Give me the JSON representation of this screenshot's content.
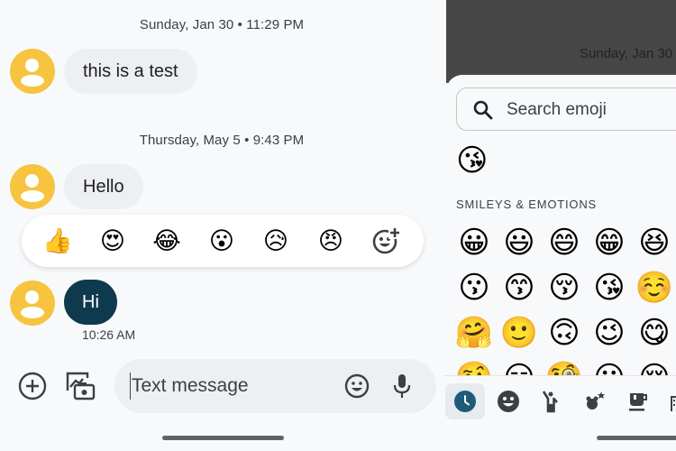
{
  "conversation": {
    "date_separators": [
      "Sunday, Jan 30 • 11:29 PM",
      "Thursday, May 5 • 9:43 PM"
    ],
    "messages": [
      {
        "text": "this is a test",
        "sender": "contact"
      },
      {
        "text": "Hello",
        "sender": "contact"
      },
      {
        "text": "Hi",
        "sender": "contact",
        "time": "10:26 AM",
        "selected": true
      }
    ],
    "avatar_color": "#f6c43f",
    "selected_bubble_color": "#0f3a4d"
  },
  "reactions": {
    "items": [
      {
        "emoji": "👍",
        "name": "thumbs-up"
      },
      {
        "emoji": "😍",
        "name": "heart-eyes"
      },
      {
        "emoji": "😂",
        "name": "tears-of-joy"
      },
      {
        "emoji": "😮",
        "name": "surprised"
      },
      {
        "emoji": "😥",
        "name": "sad-sweat"
      },
      {
        "emoji": "😠",
        "name": "angry"
      }
    ],
    "more_icon": "add-reaction-icon"
  },
  "compose": {
    "placeholder": "Text message",
    "value": "",
    "icons": [
      "add-icon",
      "gallery-camera-icon",
      "emoji-icon",
      "microphone-icon"
    ]
  },
  "emoji_picker": {
    "background_date": "Sunday, Jan 30 •",
    "search_placeholder": "Search emoji",
    "recent": [
      "😘"
    ],
    "section_title": "SMILEYS & EMOTIONS",
    "grid": [
      [
        "😀",
        "😃",
        "😄",
        "😁",
        "😆"
      ],
      [
        "😗",
        "😙",
        "😚",
        "😘",
        "☺️"
      ],
      [
        "🤗",
        "🙂",
        "🙃",
        "😉",
        "😋"
      ],
      [
        "🤨",
        "😏",
        "🧐",
        "😐",
        "😌"
      ]
    ],
    "categories": [
      {
        "name": "recent",
        "icon": "clock-icon",
        "active": true
      },
      {
        "name": "smileys",
        "icon": "smiley-icon",
        "active": false
      },
      {
        "name": "people",
        "icon": "person-waving-icon",
        "active": false
      },
      {
        "name": "animals-nature",
        "icon": "animals-icon",
        "active": false
      },
      {
        "name": "food-drink",
        "icon": "coffee-cup-icon",
        "active": false
      },
      {
        "name": "travel-places",
        "icon": "buildings-icon",
        "active": false
      }
    ]
  }
}
